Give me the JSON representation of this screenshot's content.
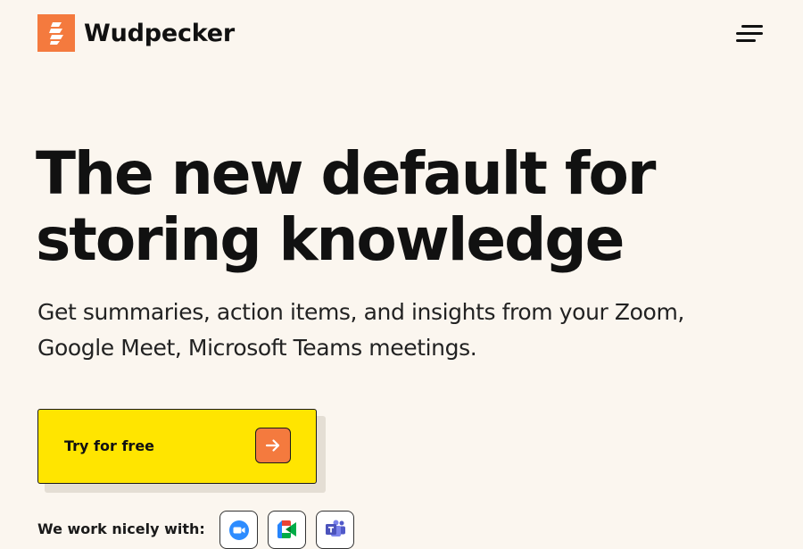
{
  "brand": {
    "name": "Wudpecker",
    "logo_color": "#F47A3E"
  },
  "header": {
    "menu_icon": "hamburger-menu-icon"
  },
  "hero": {
    "title_line1": "The new default for",
    "title_line2": "storing knowledge",
    "subtitle_line1": "Get summaries, action items, and insights from your Zoom,",
    "subtitle_line2": "Google Meet, Microsoft Teams meetings."
  },
  "cta": {
    "label": "Try for free",
    "icon": "arrow-right-icon",
    "background": "#FFE500",
    "arrow_background": "#F47A3E"
  },
  "integrations": {
    "label": "We work nicely with:",
    "items": [
      {
        "name": "Zoom",
        "icon": "zoom-icon",
        "color": "#2D8CFF"
      },
      {
        "name": "Google Meet",
        "icon": "google-meet-icon",
        "color": "#00832D"
      },
      {
        "name": "Microsoft Teams",
        "icon": "microsoft-teams-icon",
        "color": "#5059C9"
      }
    ]
  },
  "colors": {
    "page_background": "#FBF6EF",
    "text": "#111111"
  }
}
